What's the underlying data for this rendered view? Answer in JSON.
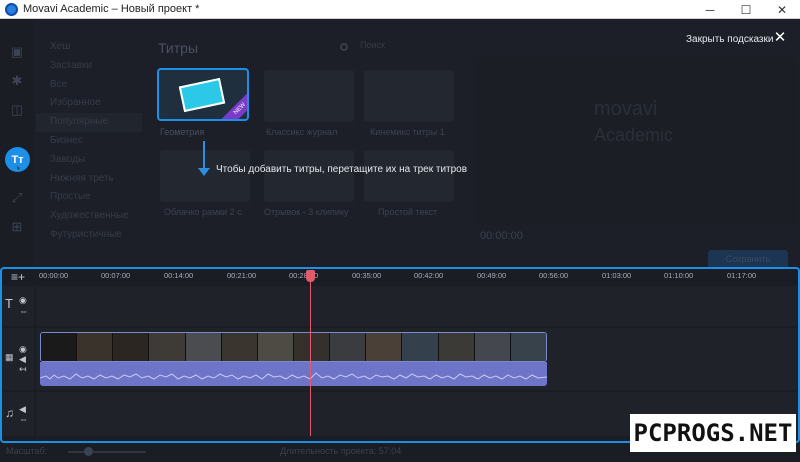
{
  "window": {
    "title": "Movavi Academic – Новый проект *",
    "minimize": "─",
    "maximize": "☐",
    "close": "✕"
  },
  "sidebar": {
    "active_label": "Tт",
    "icons": [
      "import-icon",
      "effects-icon",
      "filters-icon",
      "titles-icon",
      "stickers-icon",
      "transitions-icon",
      "more-icon"
    ]
  },
  "categories": [
    "Хеш",
    "Заставки",
    "Все",
    "Избранное",
    "Популярные",
    "Бизнес",
    "Заводы",
    "Нижняя треть",
    "Простые",
    "Художественные",
    "Футуристичные"
  ],
  "panel": {
    "title": "Титры",
    "search_placeholder": "Поиск"
  },
  "thumbnails": [
    {
      "label": "Геометрия",
      "badge": "NEW"
    },
    {
      "label": "Классикс журнал"
    },
    {
      "label": "Кинемикс титры 1"
    },
    {
      "label": "Облачко рамки 2 с"
    },
    {
      "label": "Отрывок - 3 клипику"
    },
    {
      "label": "Простой текст"
    }
  ],
  "hint": {
    "text": "Чтобы добавить титры, перетащите их на трек титров",
    "close_label": "Закрыть подсказки"
  },
  "preview": {
    "brand": "movavi",
    "brand_sub": "Academic",
    "timecode": "00:00:00",
    "save_button": "Сохранить"
  },
  "timeline": {
    "ticks": [
      "00:00:00",
      "00:07:00",
      "00:14:00",
      "00:21:00",
      "00:28:00",
      "00:35:00",
      "00:42:00",
      "00:49:00",
      "00:56:00",
      "01:03:00",
      "01:10:00",
      "01:17:00"
    ]
  },
  "status": {
    "scale_label": "Масштаб:",
    "duration": "Длительность проекта: 57:04"
  },
  "watermark": "PCPROGS.NET",
  "colors": {
    "accent": "#1c8fe8",
    "playhead": "#e25b6b",
    "audio": "#6e74c8"
  }
}
